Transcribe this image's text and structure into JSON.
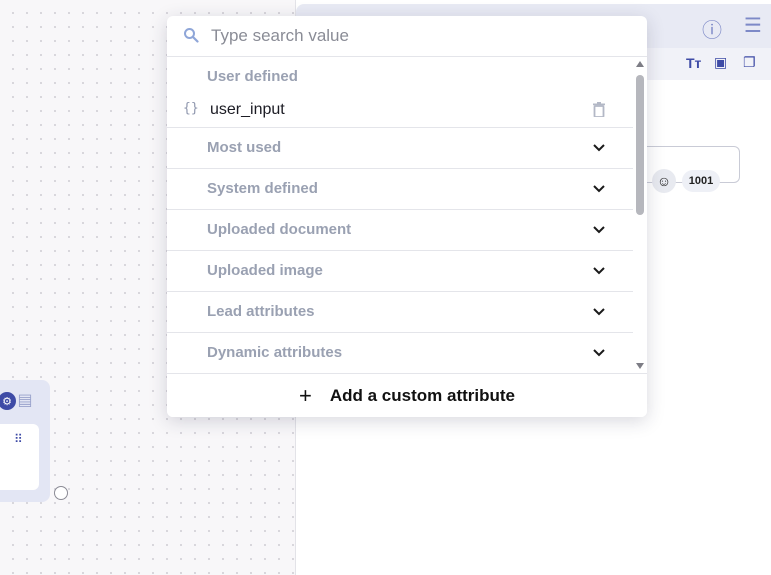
{
  "search": {
    "placeholder": "Type search value",
    "value": ""
  },
  "sections": {
    "user_defined": {
      "label": "User defined",
      "items": [
        {
          "name": "user_input"
        }
      ]
    }
  },
  "groups": [
    {
      "label": "Most used"
    },
    {
      "label": "System defined"
    },
    {
      "label": "Uploaded document"
    },
    {
      "label": "Uploaded image"
    },
    {
      "label": "Lead attributes"
    },
    {
      "label": "Dynamic attributes"
    }
  ],
  "footer": {
    "add_label": "Add a custom attribute"
  },
  "editor": {
    "char_count": "1001"
  },
  "colors": {
    "accent": "#3e4ba6",
    "muted_text": "#9aa1b2",
    "header_bg": "#e8eaf4"
  },
  "icons": {
    "search": "search-icon",
    "variable": "braces-icon",
    "delete": "trash-icon",
    "expand": "chevron-down-icon",
    "add": "plus-icon",
    "info": "info-icon",
    "collapse": "collapse-panel-icon",
    "emoji": "emoji-icon"
  }
}
